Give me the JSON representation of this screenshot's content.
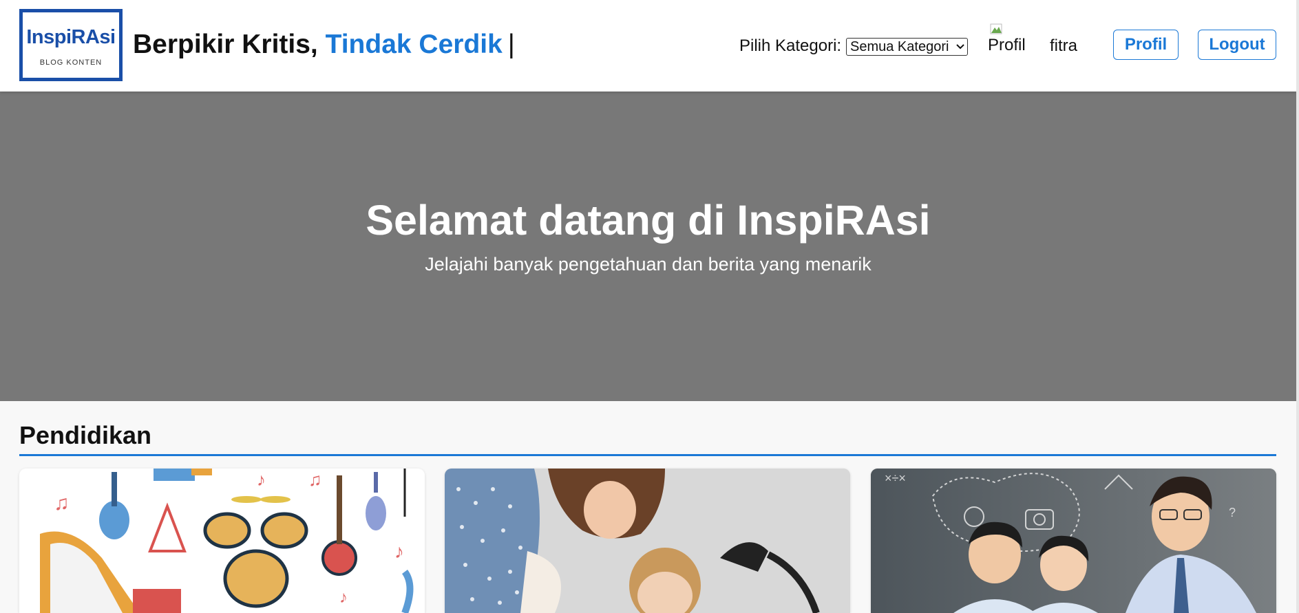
{
  "header": {
    "logo": {
      "title": "InspiRAsi",
      "subtitle": "BLOG KONTEN"
    },
    "tagline": {
      "part1": "Berpikir Kritis, ",
      "part2": "Tindak Cerdik",
      "cursor": "|"
    },
    "category": {
      "label": "Pilih Kategori:",
      "selected": "Semua Kategori"
    },
    "avatar_alt": "Profil",
    "username": "fitra",
    "profile_button": "Profil",
    "logout_button": "Logout"
  },
  "hero": {
    "title": "Selamat datang di InspiRAsi",
    "subtitle": "Jelajahi banyak pengetahuan dan berita yang menarik"
  },
  "section": {
    "title": "Pendidikan",
    "cards": [
      {
        "image": "musical-instruments-illustration"
      },
      {
        "image": "teacher-helping-girl-study-photo"
      },
      {
        "image": "teacher-children-classroom-photo"
      }
    ]
  },
  "colors": {
    "brand": "#1a4fa8",
    "accent": "#1a78d6",
    "hero_bg": "#787878",
    "page_bg": "#f8f8f8"
  }
}
